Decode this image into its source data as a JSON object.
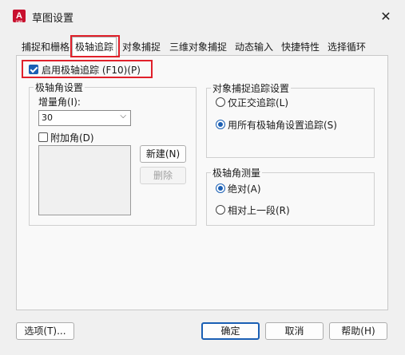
{
  "window": {
    "title": "草图设置",
    "app_icon_letter": "A",
    "app_icon_sub": "CAD"
  },
  "tabs": [
    {
      "label": "捕捉和栅格"
    },
    {
      "label": "极轴追踪"
    },
    {
      "label": "对象捕捉"
    },
    {
      "label": "三维对象捕捉"
    },
    {
      "label": "动态输入"
    },
    {
      "label": "快捷特性"
    },
    {
      "label": "选择循环"
    }
  ],
  "selected_tab": "极轴追踪",
  "enable_polar": {
    "label": "启用极轴追踪 (F10)(P)",
    "checked": true
  },
  "polar_settings": {
    "legend": "极轴角设置",
    "increment_label": "增量角(I):",
    "increment_value": "30",
    "additional_label": "附加角(D)",
    "additional_checked": false,
    "new_button": "新建(N)",
    "delete_button": "删除"
  },
  "snap_tracking": {
    "legend": "对象捕捉追踪设置",
    "options": [
      {
        "label": "仅正交追踪(L)",
        "selected": false
      },
      {
        "label": "用所有极轴角设置追踪(S)",
        "selected": true
      }
    ]
  },
  "polar_measure": {
    "legend": "极轴角测量",
    "options": [
      {
        "label": "绝对(A)",
        "selected": true
      },
      {
        "label": "相对上一段(R)",
        "selected": false
      }
    ]
  },
  "footer": {
    "options_button": "选项(T)...",
    "ok_button": "确定",
    "cancel_button": "取消",
    "help_button": "帮助(H)"
  },
  "colors": {
    "accent": "#1a5fb4",
    "highlight": "#e0202a"
  }
}
